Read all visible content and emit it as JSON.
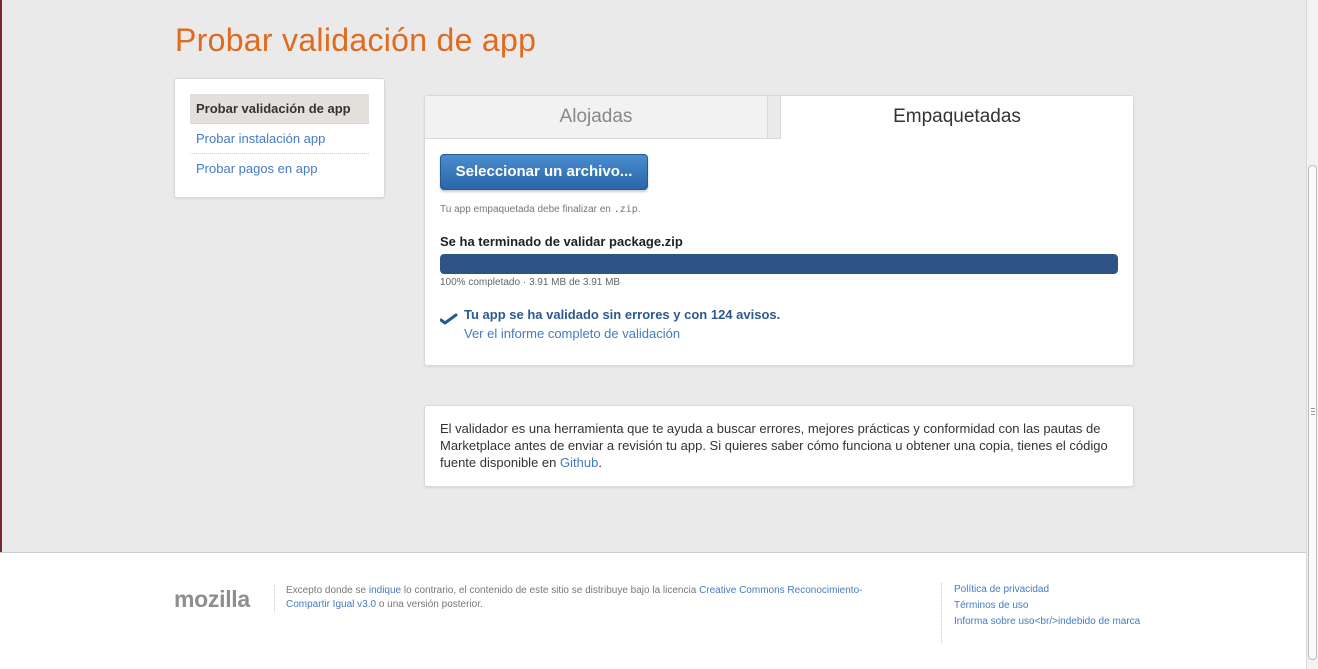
{
  "page": {
    "title": "Probar validación de app"
  },
  "sidebar": {
    "items": [
      {
        "label": "Probar validación de app",
        "active": true
      },
      {
        "label": "Probar instalación app",
        "active": false
      },
      {
        "label": "Probar pagos en app",
        "active": false
      }
    ]
  },
  "tabs": {
    "hosted": "Alojadas",
    "packaged": "Empaquetadas",
    "selected": "Empaquetadas"
  },
  "upload": {
    "button_label": "Seleccionar un archivo...",
    "hint_prefix": "Tu app empaquetada debe finalizar en",
    "hint_ext": ".zip",
    "hint_suffix": ".",
    "status": "Se ha terminado de validar package.zip",
    "progress_percent": 100,
    "progress_text": "100% completado · 3.91 MB de 3.91 MB",
    "success_message": "Tu app se ha validado sin errores y con 124 avisos.",
    "report_link": "Ver el informe completo de validación"
  },
  "info": {
    "text": "El validador es una herramienta que te ayuda a buscar errores, mejores prácticas y conformidad con las pautas de Marketplace antes de enviar a revisión tu app. Si quieres saber cómo funciona u obtener una copia, tienes el código fuente disponible en",
    "link": "Github",
    "end": "."
  },
  "footer": {
    "logo": "mozilla",
    "license_1": "Excepto donde se",
    "license_link_1": "indique",
    "license_2": "lo contrario, el contenido de este sitio se distribuye bajo la licencia",
    "license_link_2": "Creative Commons Reconocimiento-Compartir Igual v3.0",
    "license_3": "o una versión posterior.",
    "links": [
      "Política de privacidad",
      "Términos de uso",
      "Informa sobre uso<br/>indebido de marca"
    ]
  },
  "colors": {
    "title": "#e06a1d",
    "link": "#447bc4",
    "button": "#2a66a8",
    "progress": "#2e5384"
  }
}
